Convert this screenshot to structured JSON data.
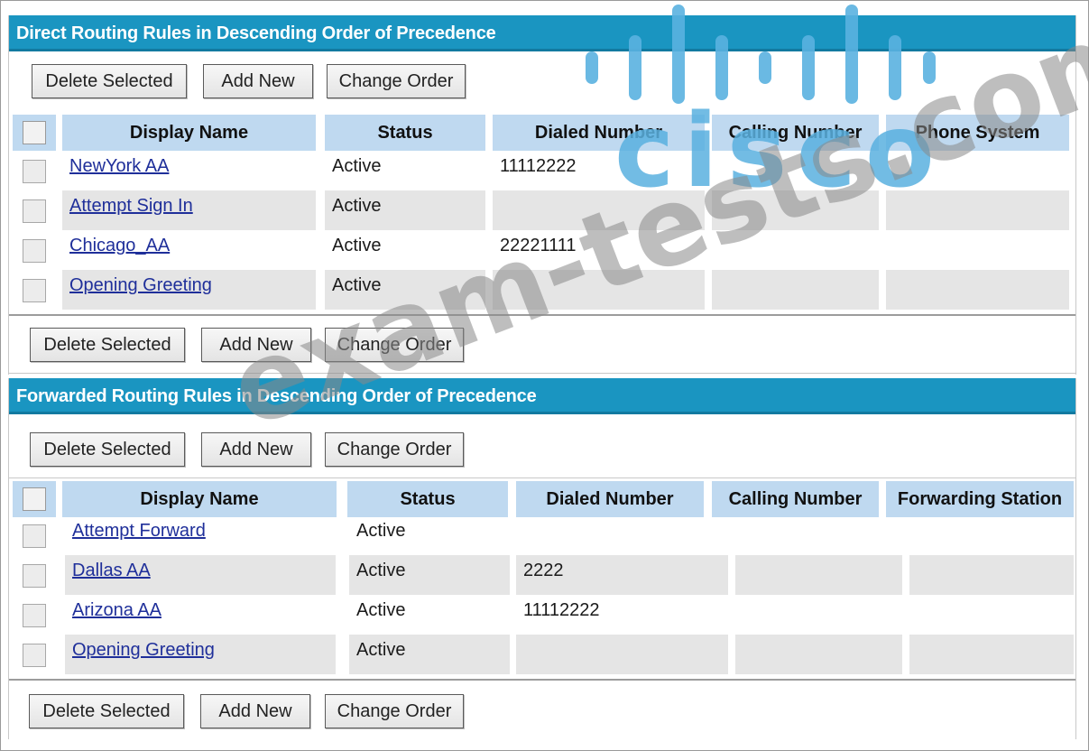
{
  "buttons": {
    "delete": "Delete Selected",
    "add": "Add New",
    "change_order": "Change Order"
  },
  "direct": {
    "title": "Direct Routing Rules in Descending Order of Precedence",
    "headers": [
      "Display Name",
      "Status",
      "Dialed Number",
      "Calling Number",
      "Phone System"
    ],
    "rows": [
      {
        "name": "NewYork AA",
        "status": "Active",
        "dialed": "11112222",
        "calling": "",
        "extra": ""
      },
      {
        "name": "Attempt Sign In",
        "status": "Active",
        "dialed": "",
        "calling": "",
        "extra": ""
      },
      {
        "name": "Chicago_AA",
        "status": "Active",
        "dialed": "22221111",
        "calling": "",
        "extra": ""
      },
      {
        "name": "Opening Greeting",
        "status": "Active",
        "dialed": "",
        "calling": "",
        "extra": ""
      }
    ]
  },
  "forwarded": {
    "title": "Forwarded Routing Rules in Descending Order of Precedence",
    "headers": [
      "Display Name",
      "Status",
      "Dialed Number",
      "Calling Number",
      "Forwarding Station"
    ],
    "rows": [
      {
        "name": "Attempt Forward",
        "status": "Active",
        "dialed": "",
        "calling": "",
        "extra": ""
      },
      {
        "name": "Dallas AA",
        "status": "Active",
        "dialed": "2222",
        "calling": "",
        "extra": ""
      },
      {
        "name": "Arizona AA",
        "status": "Active",
        "dialed": "11112222",
        "calling": "",
        "extra": ""
      },
      {
        "name": "Opening Greeting",
        "status": "Active",
        "dialed": "",
        "calling": "",
        "extra": ""
      }
    ]
  },
  "watermark": {
    "logo": "cisco",
    "text": "exam-tests.com",
    "logo_color": "#5ab1e0"
  },
  "colors": {
    "title_bar": "#1a95c1",
    "header": "#bfd9f0",
    "row_shade": "#e5e5e5",
    "link": "#1f2f9a"
  }
}
